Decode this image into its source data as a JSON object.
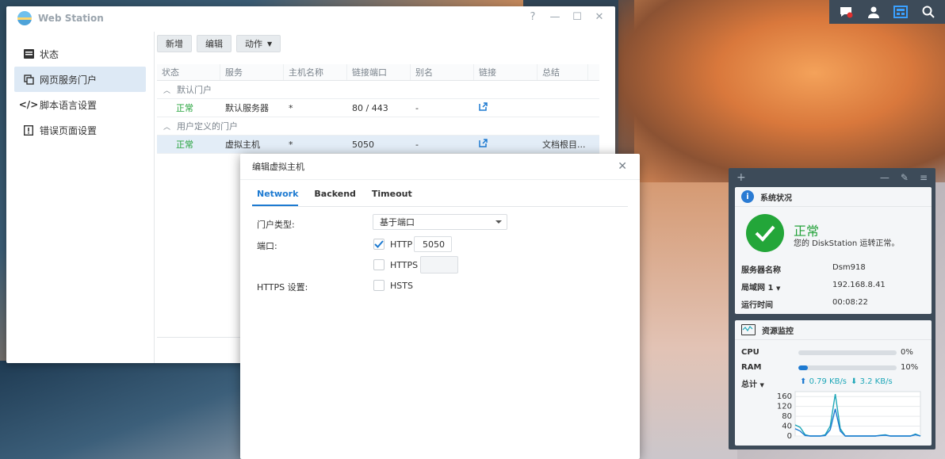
{
  "colors": {
    "accent": "#1d7ad1",
    "ok": "#25a33b",
    "panel": "#3d4b59"
  },
  "tray": {
    "icons": [
      "notification-chat-icon",
      "user-icon",
      "widgets-icon",
      "search-icon"
    ]
  },
  "window": {
    "title": "Web Station",
    "controls": [
      "?",
      "—",
      "☐",
      "✕"
    ],
    "sidebar": {
      "items": [
        {
          "label": "状态",
          "icon": "status-icon"
        },
        {
          "label": "网页服务门户",
          "icon": "portal-icon",
          "active": true
        },
        {
          "label": "脚本语言设置",
          "icon": "code-icon"
        },
        {
          "label": "错误页面设置",
          "icon": "error-page-icon"
        }
      ]
    },
    "toolbar": {
      "add": "新增",
      "edit": "编辑",
      "action": "动作"
    },
    "table": {
      "columns": [
        "状态",
        "服务",
        "主机名称",
        "链接端口",
        "别名",
        "链接",
        "总结"
      ],
      "groups": [
        {
          "name": "默认门户",
          "rows": [
            {
              "status": "正常",
              "service": "默认服务器",
              "host": "*",
              "port": "80 / 443",
              "alias": "-",
              "summary": ""
            }
          ]
        },
        {
          "name": "用户定义的门户",
          "rows": [
            {
              "status": "正常",
              "service": "虚拟主机",
              "host": "*",
              "port": "5050",
              "alias": "-",
              "summary": "文档根目..."
            }
          ]
        }
      ]
    }
  },
  "dialog": {
    "title": "编辑虚拟主机",
    "tabs": [
      "Network",
      "Backend",
      "Timeout"
    ],
    "portal_type_label": "门户类型:",
    "portal_type_value": "基于端口",
    "port_label": "端口:",
    "http_label": "HTTP",
    "http_port": "5050",
    "http_checked": true,
    "https_label": "HTTPS",
    "https_port": "",
    "https_checked": false,
    "https_settings_label": "HTTPS 设置:",
    "hsts_label": "HSTS",
    "hsts_checked": false
  },
  "widgets": {
    "system": {
      "title": "系统状况",
      "status": "正常",
      "desc": "您的 DiskStation 运转正常。",
      "rows": [
        {
          "k": "服务器名称",
          "v": "Dsm918"
        },
        {
          "k": "局域网 1",
          "v": "192.168.8.41"
        },
        {
          "k": "运行时间",
          "v": "00:08:22"
        }
      ]
    },
    "monitor": {
      "title": "资源监控",
      "cpu_label": "CPU",
      "cpu_pct": "0%",
      "cpu_value": 0,
      "ram_label": "RAM",
      "ram_pct": "10%",
      "ram_value": 10,
      "total_label": "总计",
      "upload": "0.79 KB/s",
      "download": "3.2 KB/s"
    }
  },
  "chart_data": {
    "type": "line",
    "yticks": [
      160,
      120,
      80,
      40,
      0
    ],
    "ylim": [
      0,
      180
    ],
    "series": [
      {
        "values": [
          45,
          35,
          5,
          0,
          0,
          0,
          5,
          40,
          170,
          30,
          0,
          0,
          0,
          0,
          0,
          0,
          0,
          3,
          5,
          0,
          0,
          0,
          0,
          0,
          8,
          0
        ]
      },
      {
        "values": [
          30,
          20,
          2,
          0,
          0,
          0,
          2,
          25,
          110,
          20,
          0,
          0,
          0,
          0,
          0,
          0,
          0,
          2,
          3,
          0,
          0,
          0,
          0,
          0,
          5,
          0
        ]
      }
    ]
  }
}
